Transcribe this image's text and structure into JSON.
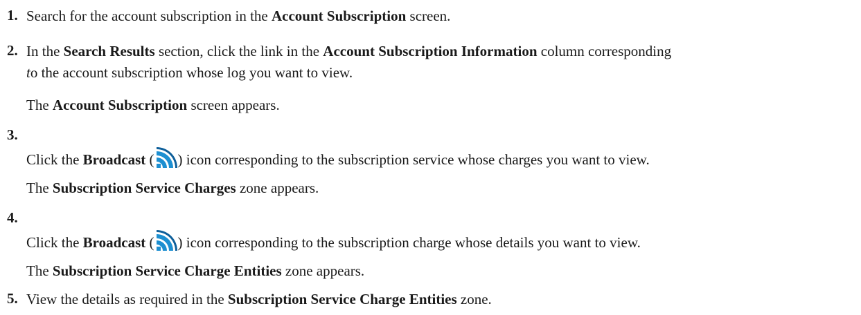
{
  "steps": [
    {
      "number": "1.",
      "instruction": {
        "t1": "Search for the account subscription in the ",
        "b1": "Account Subscription",
        "t2": " screen."
      }
    },
    {
      "number": "2.",
      "instruction": {
        "t1": "In the ",
        "b1": "Search Results",
        "t2": " section, click the link in the ",
        "b2": "Account Subscription Information",
        "t3": " column corresponding",
        "l2_i": "t",
        "l2_t": "o the account subscription whose log you want to view."
      },
      "result": {
        "t1": "The ",
        "b1": "Account Subscription",
        "t2": " screen appears."
      }
    },
    {
      "number": "3.",
      "instruction": {
        "t1": "Click the ",
        "b1": "Broadcast",
        "t2": " (",
        "icon": "broadcast-icon",
        "t3": ") icon corresponding to the subscription service whose charges you want to view."
      },
      "result": {
        "t1": "The ",
        "b1": "Subscription Service Charges",
        "t2": " zone appears."
      }
    },
    {
      "number": "4.",
      "instruction": {
        "t1": "Click the ",
        "b1": "Broadcast",
        "t2": " (",
        "icon": "broadcast-icon",
        "t3": ") icon corresponding to the subscription charge whose details you want to view."
      },
      "result": {
        "t1": "The ",
        "b1": "Subscription Service Charge Entities",
        "t2": " zone appears."
      }
    },
    {
      "number": "5.",
      "instruction": {
        "t1": "View the details as required in the ",
        "b1": "Subscription Service Charge Entities",
        "t2": " zone."
      }
    }
  ],
  "icon_colors": {
    "broadcast_primary": "#1d8fd1",
    "broadcast_dark": "#0e5f9a"
  }
}
